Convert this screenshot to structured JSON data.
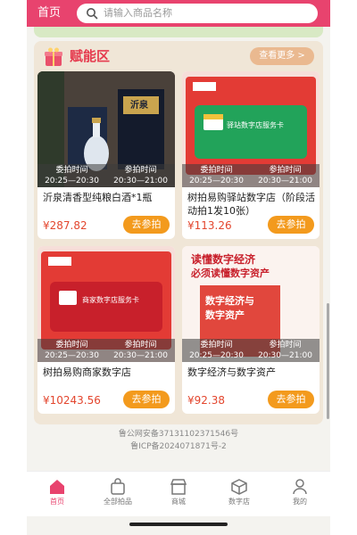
{
  "header": {
    "home_label": "首页",
    "search_placeholder": "请输入商品名称"
  },
  "section": {
    "title": "赋能区",
    "more_label": "查看更多 >"
  },
  "items": [
    {
      "title": "沂泉清香型纯粮白酒*1瓶",
      "price": "¥287.82",
      "time_label": "委拍时间",
      "time": "20:25—20:30",
      "join_time_label": "参拍时间",
      "join_time": "20:30—21:00",
      "button": "去参拍",
      "image_icon": "liquor-bottle-image",
      "brand_text": "沂泉"
    },
    {
      "title": "树拍易购驿站数字店（阶段活动拍1发10张）",
      "price": "¥113.26",
      "time_label": "委拍时间",
      "time": "20:25—20:30",
      "join_time_label": "参拍时间",
      "join_time": "20:30—21:00",
      "button": "去参拍",
      "image_icon": "green-service-card-image",
      "card_text": "驿站数字店服务卡"
    },
    {
      "title": "树拍易购商家数字店",
      "price": "¥10243.56",
      "time_label": "委拍时间",
      "time": "20:25—20:30",
      "join_time_label": "参拍时间",
      "join_time": "20:30—21:00",
      "button": "去参拍",
      "image_icon": "red-service-card-image",
      "card_text": "商家数字店服务卡"
    },
    {
      "title": "数字经济与数字资产",
      "price": "¥92.38",
      "time_label": "委拍时间",
      "time": "20:25—20:30",
      "join_time_label": "参拍时间",
      "join_time": "20:30—21:00",
      "button": "去参拍",
      "image_icon": "book-cover-image",
      "book_line1": "读懂数字经济",
      "book_line2": "必须读懂数字资产",
      "book_title": "数字经济与数字资产"
    }
  ],
  "footer": {
    "line1": "鲁公网安备37131102371546号",
    "line2": "鲁ICP备2024071871号-2"
  },
  "nav": [
    {
      "label": "首页",
      "icon": "home-icon",
      "active": true
    },
    {
      "label": "全部拍品",
      "icon": "bag-icon",
      "active": false
    },
    {
      "label": "商城",
      "icon": "shop-icon",
      "active": false
    },
    {
      "label": "数字店",
      "icon": "cube-icon",
      "active": false
    },
    {
      "label": "我的",
      "icon": "user-icon",
      "active": false
    }
  ],
  "colors": {
    "brand": "#e8436e",
    "accent": "#f39a1d",
    "price": "#e3462e"
  }
}
